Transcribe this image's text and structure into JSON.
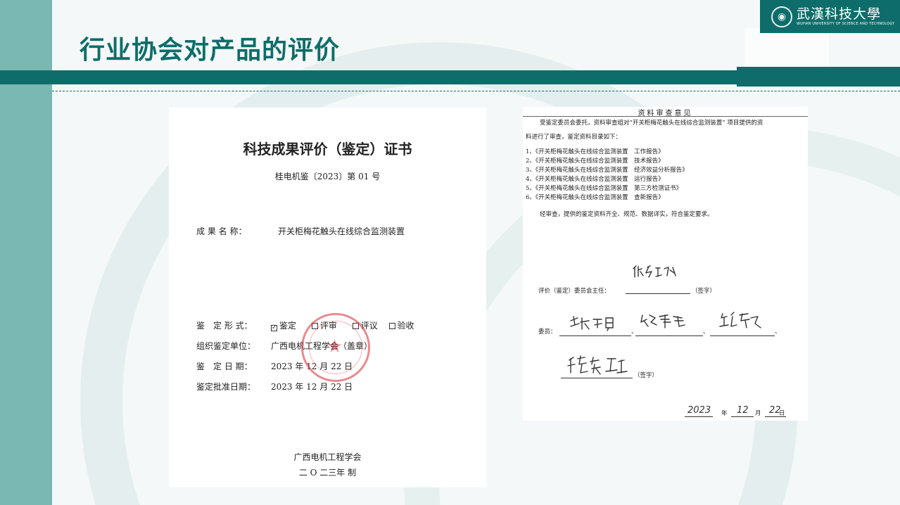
{
  "slide": {
    "title": "行业协会对产品的评价",
    "logo": {
      "name_cn": "武漢科技大學",
      "name_en": "WUHAN UNIVERSITY OF SCIENCE AND TECHNOLOGY",
      "icon": "university-seal-icon"
    },
    "colors": {
      "brand": "#0e6d6a",
      "left_band": "#7ab8b4",
      "seal": "#dc2832"
    }
  },
  "certificate": {
    "title": "科技成果评价（鉴定）证书",
    "number": "桂电机鉴〔2023〕第 01 号",
    "fields": {
      "name_label": "成 果 名 称：",
      "name_value": "开关柜梅花触头在线综合监测装置",
      "form_label": "鉴　定 形 式：",
      "form_options": [
        "鉴定",
        "评审",
        "评议",
        "验收"
      ],
      "org_label": "组织鉴定单位：",
      "org_value": "广西电机工程学会（盖章）",
      "date_label": "鉴　定 日 期：",
      "date_value": "2023 年 12 月 22 日",
      "approve_label": "鉴定批准日期：",
      "approve_value": "2023 年 12 月 22 日"
    },
    "footer_org": "广西电机工程学会",
    "footer_year": "二 O 二三年  制",
    "seal_icon": "red-seal-stamp"
  },
  "review": {
    "title": "资料审查意见",
    "intro_1": "受鉴定委员会委托，资料审查组对“开关柜梅花触头在线综合监测装置” 项目提供的资",
    "intro_2": "料进行了审查，鉴定资料目录如下：",
    "items": [
      "1、《开关柜梅花触头在线综合监测装置　工作报告》",
      "2、《开关柜梅花触头在线综合监测装置　技术报告》",
      "3、《开关柜梅花触头在线综合监测装置　经济效益分析报告》",
      "4、《开关柜梅花触头在线综合监测装置　运行报告》",
      "5、《开关柜梅花触头在线综合监测装置　第三方检测证书》",
      "6、《开关柜梅花触头在线综合监测装置　查新报告》"
    ],
    "conclusion": "经审查，提供的鉴定资料齐全、规范、数据详实，符合鉴定要求。",
    "chair_label": "评价（鉴定）委员会主任：",
    "sign_note": "（签字）",
    "members_label": "委员：",
    "sep": "、",
    "sign_note_2": "（签字）",
    "date_year": "2023",
    "date_y": "年",
    "date_month": "12",
    "date_m": "月",
    "date_day": "22",
    "date_d": "日"
  }
}
